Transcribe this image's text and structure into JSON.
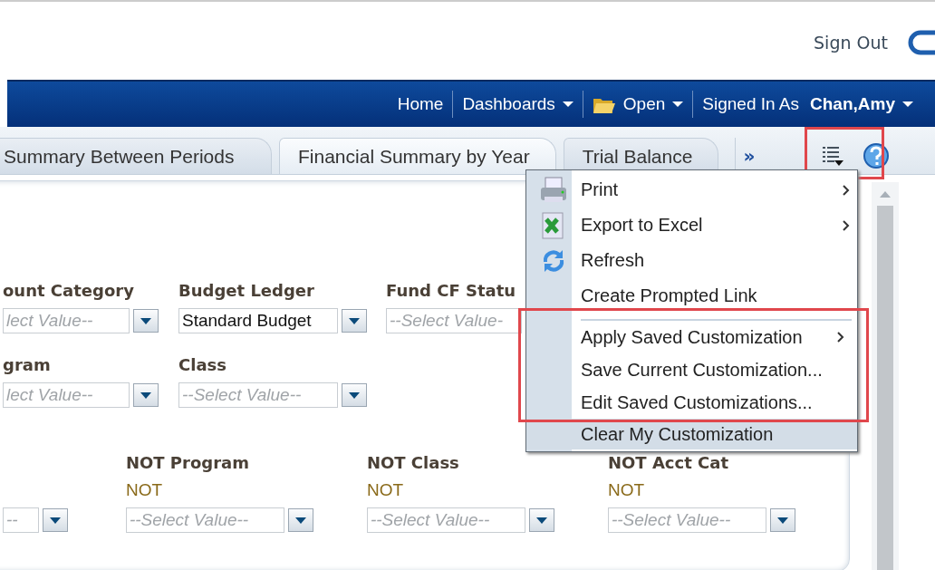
{
  "header": {
    "sign_out": "Sign Out"
  },
  "nav": [
    {
      "kind": "link",
      "label": "Home",
      "caret": false
    },
    {
      "kind": "link",
      "label": "Dashboards",
      "caret": true
    },
    {
      "kind": "folder",
      "label": "Open",
      "caret": true
    },
    {
      "kind": "user",
      "label": "Signed In As",
      "user": "Chan,Amy",
      "caret": true
    }
  ],
  "tabs": [
    {
      "label": "Summary Between Periods",
      "selected": false
    },
    {
      "label": "Financial Summary by Year",
      "selected": true
    },
    {
      "label": "Trial Balance",
      "selected": false
    }
  ],
  "more_tabs": "»",
  "page_options": {
    "callout": true
  },
  "filter_rows": [
    {
      "kind": "top",
      "filters": [
        {
          "label": "ount Category",
          "placeholder": "lect Value--"
        },
        {
          "label": "Budget Ledger",
          "value": "Standard Budget"
        },
        {
          "label": "Fund CF Statu",
          "placeholder": "--Select Value-",
          "button": false
        }
      ]
    },
    {
      "kind": "middle",
      "filters": [
        {
          "label": "gram",
          "placeholder": "lect Value--"
        },
        {
          "label": "Class",
          "placeholder": "--Select Value--"
        }
      ]
    },
    {
      "kind": "bottom",
      "filters": [
        {
          "placeholder": "--"
        },
        {
          "label": "NOT Program",
          "prefix": "NOT",
          "placeholder": "--Select Value--"
        },
        {
          "label": "NOT Class",
          "prefix": "NOT",
          "placeholder": "--Select Value--"
        },
        {
          "label": "NOT Acct Cat",
          "prefix": "NOT",
          "placeholder": "--Select Value--"
        }
      ]
    }
  ],
  "menu": [
    {
      "label": "Print",
      "submenu": true,
      "separator_before": false,
      "highlighted": false,
      "callout": false
    },
    {
      "label": "Export to Excel",
      "submenu": true,
      "separator_before": false,
      "highlighted": false,
      "callout": false
    },
    {
      "label": "Refresh",
      "submenu": false,
      "separator_before": false,
      "highlighted": false,
      "callout": false
    },
    {
      "label": "Create Prompted Link",
      "submenu": false,
      "separator_before": false,
      "highlighted": false,
      "callout": false
    },
    {
      "label": "Apply Saved Customization",
      "submenu": true,
      "separator_before": true,
      "highlighted": false,
      "callout": true
    },
    {
      "label": "Save Current Customization...",
      "submenu": false,
      "separator_before": false,
      "highlighted": false,
      "callout": true
    },
    {
      "label": "Edit Saved Customizations...",
      "submenu": false,
      "separator_before": false,
      "highlighted": false,
      "callout": true
    },
    {
      "label": "Clear My Customization",
      "submenu": false,
      "separator_before": false,
      "highlighted": true,
      "callout": false
    }
  ]
}
